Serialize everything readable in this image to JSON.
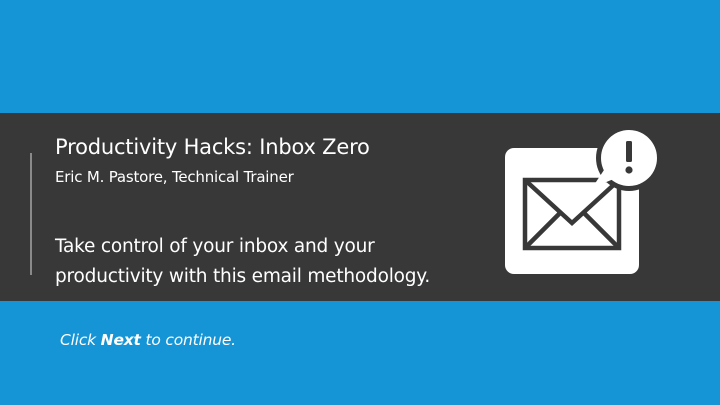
{
  "slide": {
    "title": "Productivity Hacks: Inbox Zero",
    "author": "Eric M. Pastore, Technical Trainer",
    "description_lines": [
      "Take control of your inbox and your",
      "productivity with this email methodology."
    ],
    "prompt": {
      "before": "Click ",
      "emphasis": "Next",
      "after": " to continue."
    },
    "icon": "envelope-alert-icon"
  },
  "colors": {
    "background_blue": "#1594d6",
    "band_dark": "#383838",
    "text": "#ffffff"
  }
}
